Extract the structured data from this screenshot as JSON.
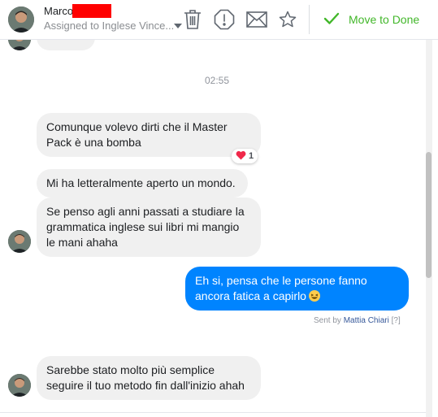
{
  "header": {
    "contact_name": "Marco",
    "assigned_label": "Assigned to Inglese Vince...",
    "move_to_done_label": "Move to Done"
  },
  "messages": {
    "timestamp": "02:55",
    "incoming_1": "Comunque volevo dirti che il Master Pack è una bomba",
    "reaction_count": "1",
    "incoming_2": "Mi ha letteralmente aperto un mondo.",
    "incoming_3": "Se penso agli anni passati a studiare la grammatica inglese sui libri mi mangio le mani ahaha",
    "outgoing_1": "Eh si, pensa che le persone fanno ancora fatica a capirlo",
    "sent_by_prefix": "Sent by",
    "sent_by_name": "Mattia Chiari",
    "sent_by_help": "[?]",
    "incoming_4": "Sarebbe stato molto più semplice seguire il tuo metodo fin dall'inizio ahah"
  },
  "colors": {
    "outgoing_bubble": "#0084ff",
    "incoming_bubble": "#f0f0f0",
    "done_accent": "#42b72a",
    "redaction": "#ff0000"
  },
  "icons": [
    "trash-icon",
    "alert-octagon-icon",
    "envelope-icon",
    "star-icon",
    "checkmark-icon",
    "heart-icon",
    "laughing-emoji-icon"
  ]
}
